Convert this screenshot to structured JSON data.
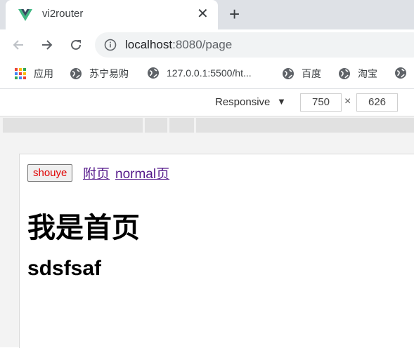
{
  "tab": {
    "title": "vi2router",
    "close": "✕",
    "new_tab": "+"
  },
  "address": {
    "host": "localhost",
    "rest": ":8080/page"
  },
  "bookmarks": [
    {
      "label": "应用",
      "icon": "apps-grid-icon"
    },
    {
      "label": "苏宁易购",
      "icon": "globe-icon"
    },
    {
      "label": "127.0.0.1:5500/ht...",
      "icon": "globe-icon"
    },
    {
      "label": "百度",
      "icon": "globe-icon"
    },
    {
      "label": "淘宝",
      "icon": "globe-icon"
    }
  ],
  "devtools": {
    "mode": "Responsive",
    "arrow": "▼",
    "width": "750",
    "height": "626",
    "times": "×"
  },
  "page": {
    "button": "shouye",
    "links": [
      "附页",
      "normal页"
    ],
    "h1": "我是首页",
    "h2": "sdsfsaf"
  },
  "colors": {
    "vue_green": "#41b883",
    "vue_dark": "#35495e",
    "link": "#551a8b",
    "button_text": "#e00000"
  }
}
